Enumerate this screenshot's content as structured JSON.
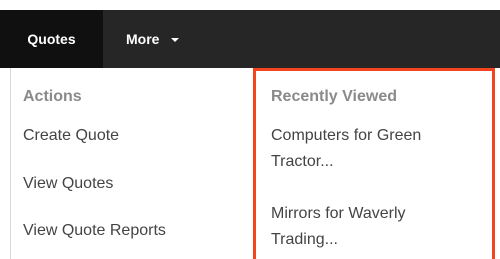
{
  "top_partial_text": "",
  "nav": {
    "active_tab": "Quotes",
    "more_label": "More"
  },
  "menu": {
    "actions_heading": "Actions",
    "actions": [
      "Create Quote",
      "View Quotes",
      "View Quote Reports"
    ],
    "recent_heading": "Recently Viewed",
    "recent": [
      "Computers for Green Tractor...",
      "Mirrors for Waverly Trading..."
    ]
  },
  "colors": {
    "navbar_bg": "#262626",
    "active_tab_bg": "#101010",
    "highlight_border": "#f4431f"
  }
}
